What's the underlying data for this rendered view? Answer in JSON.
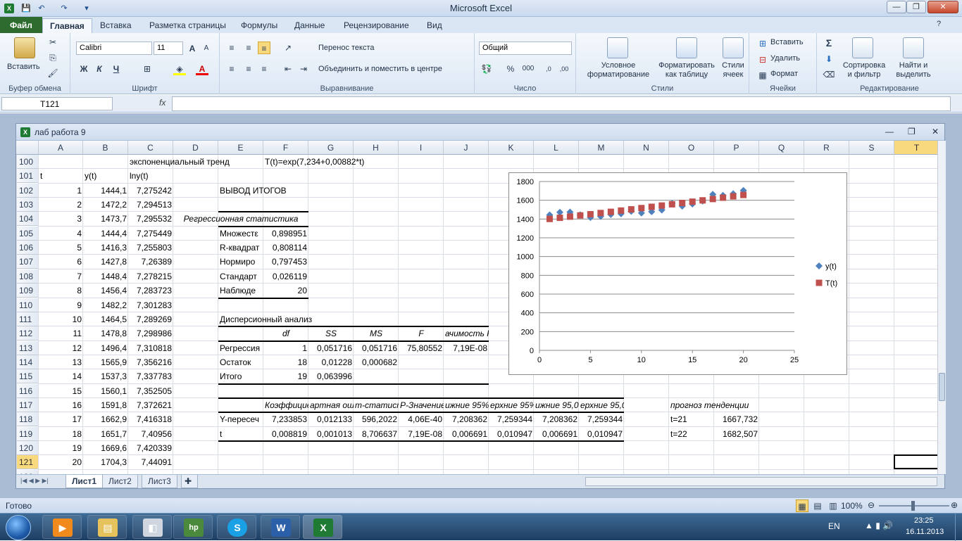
{
  "window": {
    "title": "Microsoft Excel"
  },
  "quick_access": {
    "save": "💾",
    "undo": "↶",
    "redo": "↷",
    "more": "▾"
  },
  "window_buttons": {
    "minimize": "—",
    "restore": "❐",
    "close": "✕"
  },
  "tabs": [
    "Файл",
    "Главная",
    "Вставка",
    "Разметка страницы",
    "Формулы",
    "Данные",
    "Рецензирование",
    "Вид"
  ],
  "ribbon": {
    "clipboard": {
      "paste": "Вставить",
      "label": "Буфер обмена"
    },
    "font": {
      "name": "Calibri",
      "size": "11",
      "bold": "Ж",
      "italic": "К",
      "underline": "Ч",
      "label": "Шрифт"
    },
    "alignment": {
      "wrap": "Перенос текста",
      "merge": "Объединить и поместить в центре",
      "label": "Выравнивание"
    },
    "number": {
      "format": "Общий",
      "percent": "%",
      "thousands": "000",
      "label": "Число"
    },
    "styles": {
      "conditional": "Условное форматирование",
      "as_table": "Форматировать как таблицу",
      "cell_styles": "Стили ячеек",
      "label": "Стили"
    },
    "cells": {
      "insert": "Вставить",
      "delete": "Удалить",
      "format": "Формат",
      "label": "Ячейки"
    },
    "editing": {
      "sigma": "Σ",
      "sort": "Сортировка и фильтр",
      "find": "Найти и выделить",
      "label": "Редактирование"
    }
  },
  "formula_bar": {
    "name_box": "T121",
    "fx": "fx",
    "formula": ""
  },
  "workbook": {
    "title": "лаб работа 9"
  },
  "columns": [
    "A",
    "B",
    "C",
    "D",
    "E",
    "F",
    "G",
    "H",
    "I",
    "J",
    "K",
    "L",
    "M",
    "N",
    "O",
    "P",
    "Q",
    "R",
    "S",
    "T"
  ],
  "rows": [
    "100",
    "101",
    "102",
    "103",
    "104",
    "105",
    "106",
    "107",
    "108",
    "109",
    "110",
    "111",
    "112",
    "113",
    "114",
    "115",
    "116",
    "117",
    "118",
    "119",
    "120",
    "121",
    "122"
  ],
  "cells": {
    "c100": "экспоненциальный тренд",
    "f100": "T(t)=exp(7,234+0,00882*t)",
    "a101": "t",
    "b101": "y(t)",
    "c101": "lny(t)",
    "t_values": [
      "1",
      "2",
      "3",
      "4",
      "5",
      "6",
      "7",
      "8",
      "9",
      "10",
      "11",
      "12",
      "13",
      "14",
      "15",
      "16",
      "17",
      "18",
      "19",
      "20"
    ],
    "y_values": [
      "1444,1",
      "1472,2",
      "1473,7",
      "1444,4",
      "1416,3",
      "1427,8",
      "1448,4",
      "1456,4",
      "1482,2",
      "1464,5",
      "1478,8",
      "1496,4",
      "1565,9",
      "1537,3",
      "1560,1",
      "1591,8",
      "1662,9",
      "1651,7",
      "1669,6",
      "1704,3"
    ],
    "ln_values": [
      "7,275242",
      "7,294513",
      "7,295532",
      "7,275449",
      "7,255803",
      "7,26389",
      "7,278215",
      "7,283723",
      "7,301283",
      "7,289269",
      "7,298986",
      "7,310818",
      "7,356216",
      "7,337783",
      "7,352505",
      "7,372621",
      "7,416318",
      "7,40956",
      "7,420339",
      "7,44091"
    ],
    "summary_title": "ВЫВОД ИТОГОВ",
    "reg_stats": "Регрессионная статистика",
    "stat_labels": [
      "Множестε",
      "R-квадрат",
      "Нормиро",
      "Стандарт",
      "Наблюде"
    ],
    "stat_values": [
      "0,898951",
      "0,808114",
      "0,797453",
      "0,026119",
      "20"
    ],
    "anova_title": "Дисперсионный анализ",
    "anova_headers": [
      "df",
      "SS",
      "MS",
      "F",
      "ачимость F"
    ],
    "anova_rows": [
      {
        "label": "Регрессия",
        "df": "1",
        "ss": "0,051716",
        "ms": "0,051716",
        "f": "75,80552",
        "sig": "7,19E-08"
      },
      {
        "label": "Остаток",
        "df": "18",
        "ss": "0,01228",
        "ms": "0,000682",
        "f": "",
        "sig": ""
      },
      {
        "label": "Итого",
        "df": "19",
        "ss": "0,063996",
        "ms": "",
        "f": "",
        "sig": ""
      }
    ],
    "coef_headers": [
      "Коэффициен",
      "артная оши",
      "т-статисти",
      "P-Значение",
      "ижние 95%",
      "ерхние 95%",
      "ижние 95,0",
      "ерхние 95,0%"
    ],
    "coef_rows": [
      {
        "label": "Y-пересеч",
        "v": [
          "7,233853",
          "0,012133",
          "596,2022",
          "4,06E-40",
          "7,208362",
          "7,259344",
          "7,208362",
          "7,259344"
        ]
      },
      {
        "label": "t",
        "v": [
          "0,008819",
          "0,001013",
          "8,706637",
          "7,19E-08",
          "0,006691",
          "0,010947",
          "0,006691",
          "0,010947"
        ]
      }
    ],
    "forecast_title": "прогноз тенденции",
    "forecast": [
      {
        "t": "t=21",
        "v": "1667,732"
      },
      {
        "t": "t=22",
        "v": "1682,507"
      }
    ]
  },
  "chart_data": {
    "type": "scatter",
    "x": [
      1,
      2,
      3,
      4,
      5,
      6,
      7,
      8,
      9,
      10,
      11,
      12,
      13,
      14,
      15,
      16,
      17,
      18,
      19,
      20
    ],
    "series": [
      {
        "name": "y(t)",
        "color": "#4f81bd",
        "marker": "diamond",
        "values": [
          1444.1,
          1472.2,
          1473.7,
          1444.4,
          1416.3,
          1427.8,
          1448.4,
          1456.4,
          1482.2,
          1464.5,
          1478.8,
          1496.4,
          1565.9,
          1537.3,
          1560.1,
          1591.8,
          1662.9,
          1651.7,
          1669.6,
          1704.3
        ]
      },
      {
        "name": "T(t)",
        "color": "#c0504d",
        "marker": "square",
        "values": [
          1400.8,
          1413.2,
          1425.7,
          1438.4,
          1451.1,
          1464.0,
          1477.0,
          1490.1,
          1503.3,
          1516.6,
          1530.1,
          1543.6,
          1557.3,
          1571.1,
          1585.0,
          1599.1,
          1613.3,
          1627.6,
          1642.0,
          1656.6
        ]
      }
    ],
    "xlim": [
      0,
      25
    ],
    "ylim": [
      0,
      1800
    ],
    "x_ticks": [
      0,
      5,
      10,
      15,
      20,
      25
    ],
    "y_ticks": [
      0,
      200,
      400,
      600,
      800,
      1000,
      1200,
      1400,
      1600,
      1800
    ],
    "grid": true,
    "legend": "right"
  },
  "sheets": [
    "Лист1",
    "Лист2",
    "Лист3"
  ],
  "status": {
    "ready": "Готово",
    "zoom": "100%"
  },
  "taskbar": {
    "lang": "EN",
    "time": "23:25",
    "date": "16.11.2013"
  }
}
